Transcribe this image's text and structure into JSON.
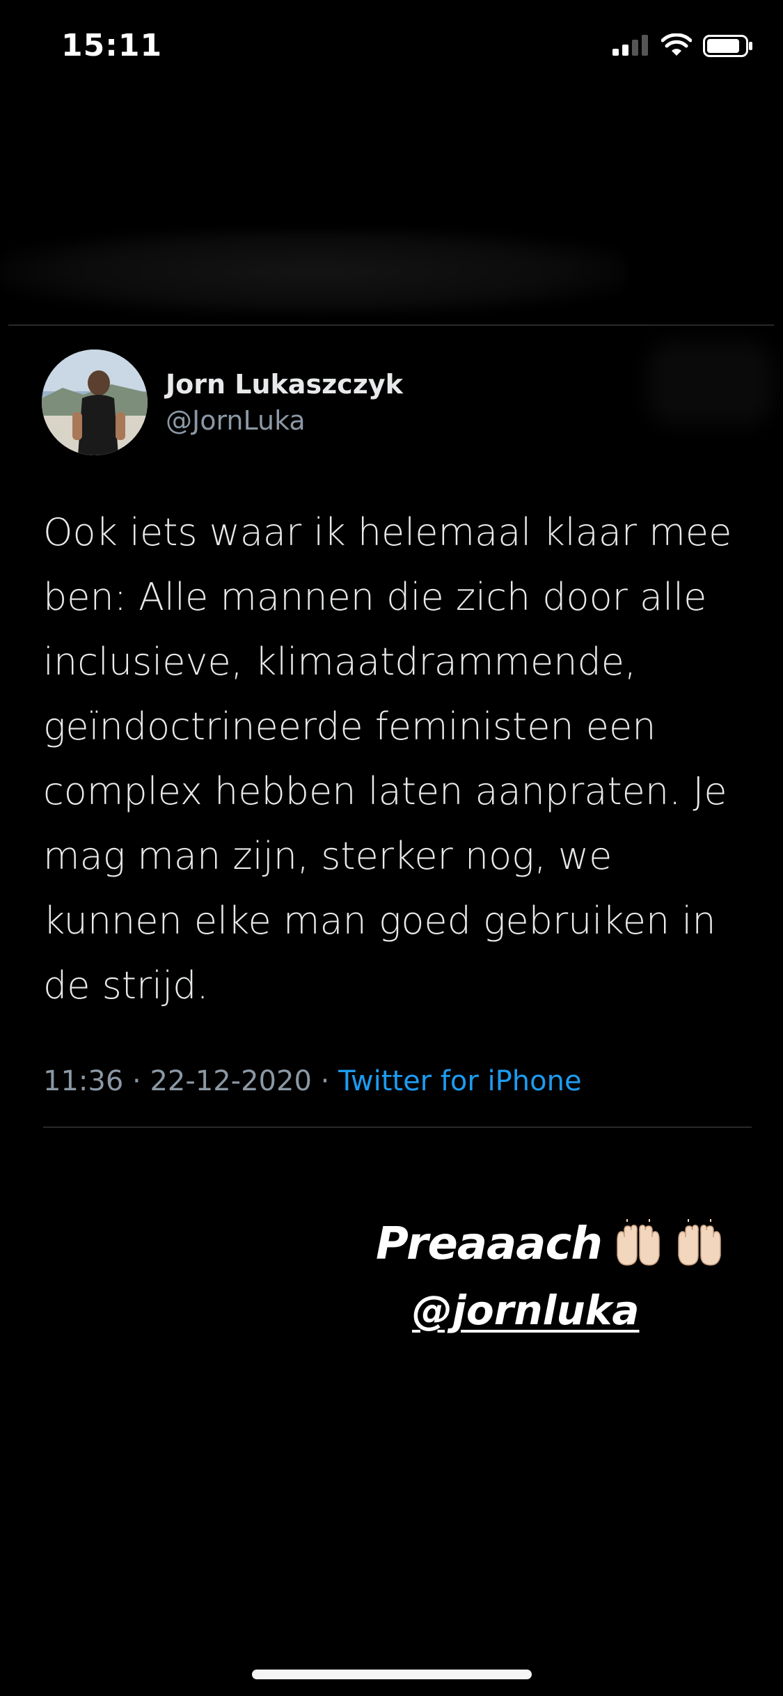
{
  "status_bar": {
    "time": "15:11",
    "icons": [
      "signal-icon",
      "wifi-icon",
      "battery-icon"
    ]
  },
  "tweet": {
    "author_name": "Jorn Lukaszczyk",
    "author_handle": "@JornLuka",
    "text": "Ook iets waar ik helemaal klaar mee ben: Alle mannen die zich door alle inclusieve, klimaatdrammende, geïndoctrineerde feministen een complex hebben laten aanpraten. Je mag man zijn, sterker nog, we kunnen elke man goed gebruiken in de strijd.",
    "time": "11:36",
    "separator": "·",
    "date": "22-12-2020",
    "source": "Twitter for iPhone"
  },
  "story_caption": {
    "line1": "Preaaach",
    "line2": "@jornluka",
    "emoji": [
      "raised-hands-icon",
      "raised-hands-icon"
    ]
  },
  "colors": {
    "background": "#000000",
    "text_primary": "#e7e9ea",
    "text_secondary": "#8b98a5",
    "link": "#1d9bf0",
    "divider": "#2a2a2a"
  }
}
